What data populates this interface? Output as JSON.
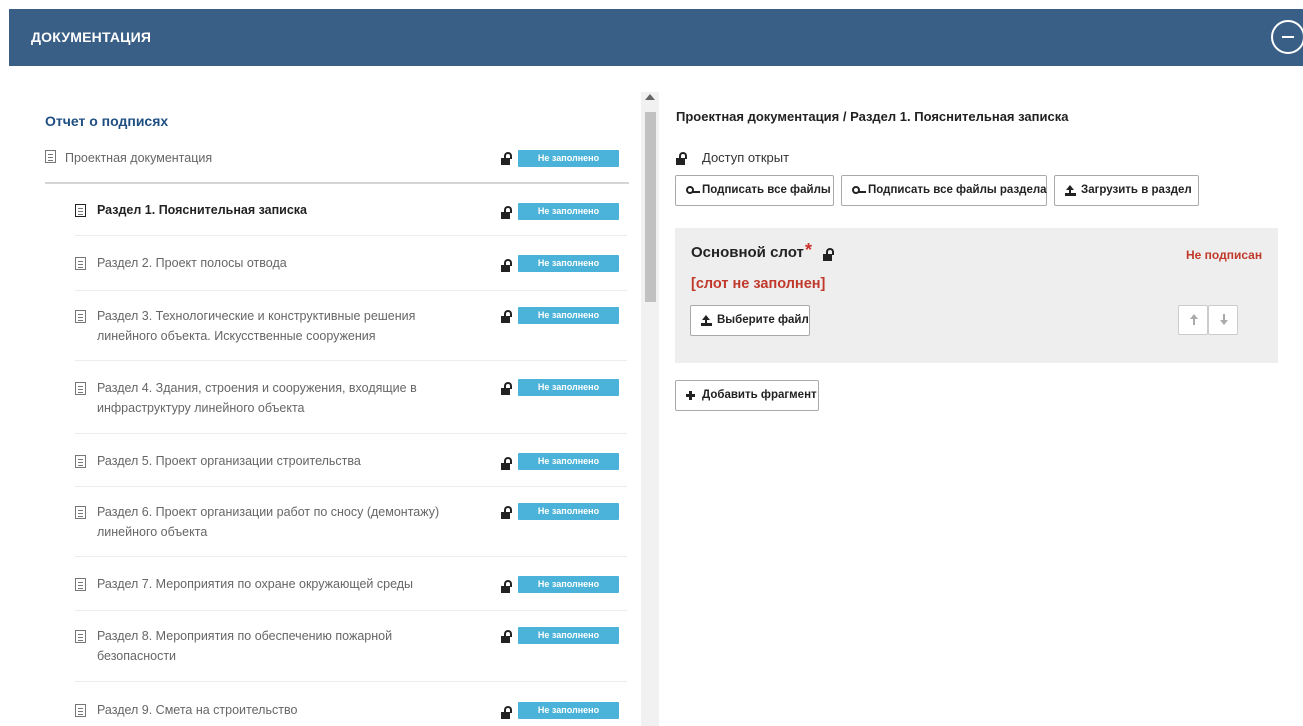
{
  "header": {
    "title": "ДОКУМЕНТАЦИЯ",
    "collapse_icon": "minus-circle-icon"
  },
  "left": {
    "report_title": "Отчет о подписях",
    "root": {
      "label": "Проектная документация",
      "status": "Не заполнено",
      "icon": "document-icon",
      "lock": "lock-open-icon"
    },
    "items": [
      {
        "label_line1": "Раздел 1. Пояснительная записка",
        "label_line2": "",
        "status": "Не заполнено",
        "active": true
      },
      {
        "label_line1": "Раздел 2. Проект полосы отвода",
        "label_line2": "",
        "status": "Не заполнено",
        "active": false
      },
      {
        "label_line1": "Раздел 3. Технологические и конструктивные решения",
        "label_line2": "линейного объекта. Искусственные сооружения",
        "status": "Не заполнено",
        "active": false
      },
      {
        "label_line1": "Раздел 4. Здания, строения и сооружения, входящие в",
        "label_line2": "инфраструктуру линейного объекта",
        "status": "Не заполнено",
        "active": false
      },
      {
        "label_line1": "Раздел 5. Проект организации строительства",
        "label_line2": "",
        "status": "Не заполнено",
        "active": false
      },
      {
        "label_line1": "Раздел 6. Проект организации работ по сносу (демонтажу)",
        "label_line2": "линейного объекта",
        "status": "Не заполнено",
        "active": false
      },
      {
        "label_line1": "Раздел 7. Мероприятия по охране окружающей среды",
        "label_line2": "",
        "status": "Не заполнено",
        "active": false
      },
      {
        "label_line1": "Раздел 8. Мероприятия по обеспечению пожарной",
        "label_line2": "безопасности",
        "status": "Не заполнено",
        "active": false
      },
      {
        "label_line1": "Раздел 9. Смета на строительство",
        "label_line2": "",
        "status": "Не заполнено",
        "active": false
      }
    ]
  },
  "right": {
    "breadcrumb": "Проектная документация / Раздел 1. Пояснительная записка",
    "access_text": "Доступ открыт",
    "buttons": {
      "sign_all": "Подписать все файлы",
      "sign_section": "Подписать все файлы раздела",
      "upload_section": "Загрузить в раздел"
    },
    "slot": {
      "title": "Основной слот",
      "required_mark": "*",
      "status": "Не подписан",
      "empty_text": "[слот не заполнен]",
      "choose_file": "Выберите файл"
    },
    "add_fragment": "Добавить фрагмент"
  },
  "colors": {
    "header_bg": "#3a5f86",
    "badge_bg": "#4bb3d9",
    "danger": "#c0392b",
    "link": "#1f4f82"
  }
}
